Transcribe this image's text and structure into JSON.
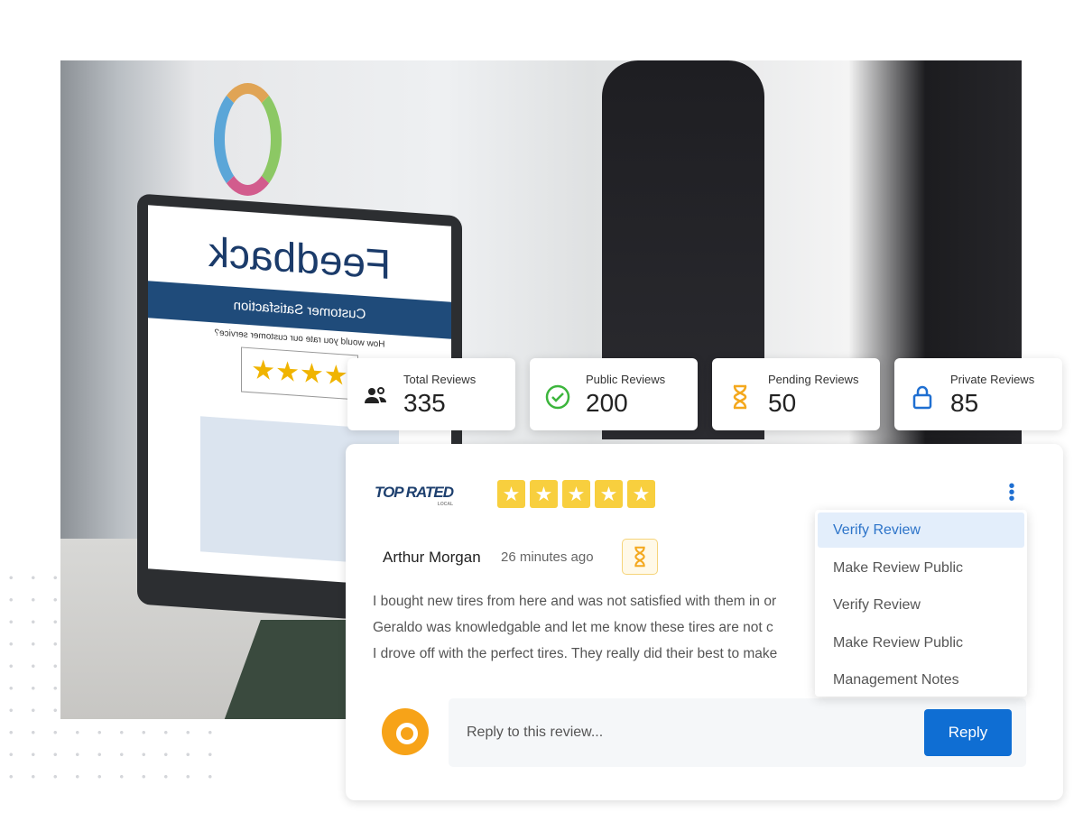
{
  "photo": {
    "laptop_title": "Feedback",
    "laptop_band": "Customer Satisfaction",
    "laptop_question": "How would you rate our customer service?",
    "laptop_stars": "★★★★"
  },
  "stats": [
    {
      "label": "Total Reviews",
      "value": "335",
      "icon": "users-icon",
      "color": "#222222"
    },
    {
      "label": "Public Reviews",
      "value": "200",
      "icon": "check-circle-icon",
      "color": "#3cb53c"
    },
    {
      "label": "Pending Reviews",
      "value": "50",
      "icon": "hourglass-icon",
      "color": "#f4a81d"
    },
    {
      "label": "Private Reviews",
      "value": "85",
      "icon": "lock-icon",
      "color": "#1f6fd1"
    }
  ],
  "review": {
    "source_logo": "TOP RATED",
    "source_logo_sub": "LOCAL",
    "rating": 5,
    "star": "★",
    "reviewer": "Arthur Morgan",
    "time": "26 minutes ago",
    "status": "pending",
    "lines": [
      "I bought new tires from here and was not satisfied with them in or",
      "Geraldo was knowledgable and let me know these tires are  not c",
      "I drove off with the perfect tires. They really did their best to make"
    ],
    "menu": [
      "Verify Review",
      "Make Review Public",
      "Verify Review",
      "Make Review Public",
      "Management Notes"
    ],
    "reply_placeholder": "Reply to this review...",
    "reply_button": "Reply"
  },
  "colors": {
    "accent": "#0f6ed3",
    "star": "#f8cf3e",
    "avatar": "#f7a318"
  }
}
